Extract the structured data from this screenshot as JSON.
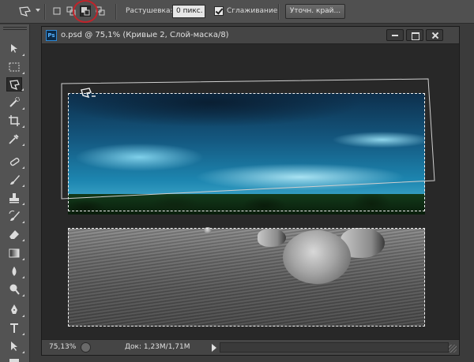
{
  "options_bar": {
    "feather_label": "Растушевка:",
    "feather_value": "0 пикс.",
    "antialias_label": "Сглаживание",
    "antialias_checked": true,
    "refine_button": "Уточн. край..."
  },
  "toolbox": {
    "tools": [
      "move-tool-icon",
      "marquee-tool-icon",
      "polygonal-lasso-tool-icon",
      "quick-selection-tool-icon",
      "crop-tool-icon",
      "eyedropper-tool-icon",
      "spot-healing-tool-icon",
      "brush-tool-icon",
      "clone-stamp-tool-icon",
      "history-brush-tool-icon",
      "eraser-tool-icon",
      "gradient-tool-icon",
      "blur-tool-icon",
      "dodge-tool-icon",
      "pen-tool-icon",
      "type-tool-icon",
      "path-selection-tool-icon",
      "rectangle-tool-icon"
    ],
    "active_tool": "polygonal-lasso-tool-icon"
  },
  "document": {
    "ps_badge": "Ps",
    "title": "o.psd @ 75,1% (Кривые 2, Слой-маска/8)",
    "zoom": "75,13%",
    "doc_size": "Док: 1,23M/1,71M"
  },
  "colors": {
    "highlight_circle": "#c0232a",
    "sky_accent": "#1d86b0"
  }
}
